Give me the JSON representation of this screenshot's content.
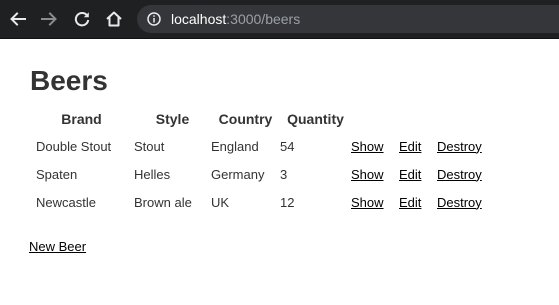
{
  "browser": {
    "url_host": "localhost",
    "url_rest": ":3000/beers"
  },
  "page": {
    "title": "Beers",
    "columns": [
      "Brand",
      "Style",
      "Country",
      "Quantity"
    ],
    "rows": [
      {
        "brand": "Double Stout",
        "style": "Stout",
        "country": "England",
        "quantity": "54"
      },
      {
        "brand": "Spaten",
        "style": "Helles",
        "country": "Germany",
        "quantity": "3"
      },
      {
        "brand": "Newcastle",
        "style": "Brown ale",
        "country": "UK",
        "quantity": "12"
      }
    ],
    "actions": {
      "show": "Show",
      "edit": "Edit",
      "destroy": "Destroy"
    },
    "new_link": "New Beer"
  }
}
